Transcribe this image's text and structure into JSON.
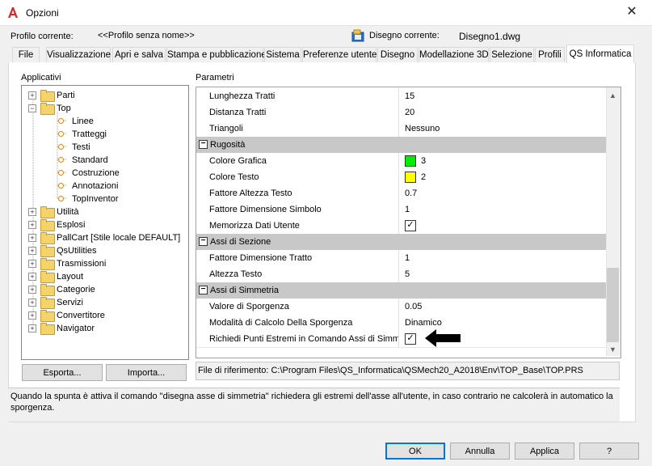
{
  "window": {
    "title": "Opzioni",
    "close_glyph": "✕"
  },
  "header": {
    "profile_label": "Profilo corrente:",
    "profile_value": "<<Profilo senza nome>>",
    "drawing_label": "Disegno corrente:",
    "drawing_value": "Disegno1.dwg"
  },
  "tabs": [
    {
      "label": "File"
    },
    {
      "label": "Visualizzazione"
    },
    {
      "label": "Apri e salva"
    },
    {
      "label": "Stampa e pubblicazione"
    },
    {
      "label": "Sistema"
    },
    {
      "label": "Preferenze utente"
    },
    {
      "label": "Disegno"
    },
    {
      "label": "Modellazione 3D"
    },
    {
      "label": "Selezione"
    },
    {
      "label": "Profili"
    },
    {
      "label": "QS Informatica",
      "active": true
    }
  ],
  "left": {
    "label": "Applicativi",
    "tree": [
      {
        "label": "Parti",
        "kind": "folder",
        "expander": "+"
      },
      {
        "label": "Top",
        "kind": "folder",
        "expander": "−"
      },
      {
        "label": "Linee",
        "kind": "leaf"
      },
      {
        "label": "Tratteggi",
        "kind": "leaf"
      },
      {
        "label": "Testi",
        "kind": "leaf"
      },
      {
        "label": "Standard",
        "kind": "leaf"
      },
      {
        "label": "Costruzione",
        "kind": "leaf"
      },
      {
        "label": "Annotazioni",
        "kind": "leaf"
      },
      {
        "label": "TopInventor",
        "kind": "leaf"
      },
      {
        "label": "Utilità",
        "kind": "folder",
        "expander": "+"
      },
      {
        "label": "Esplosi",
        "kind": "folder",
        "expander": "+"
      },
      {
        "label": "PallCart [Stile locale DEFAULT]",
        "kind": "folder",
        "expander": "+"
      },
      {
        "label": "QsUtilities",
        "kind": "folder",
        "expander": "+"
      },
      {
        "label": "Trasmissioni",
        "kind": "folder",
        "expander": "+"
      },
      {
        "label": "Layout",
        "kind": "folder",
        "expander": "+"
      },
      {
        "label": "Categorie",
        "kind": "folder",
        "expander": "+"
      },
      {
        "label": "Servizi",
        "kind": "folder",
        "expander": "+"
      },
      {
        "label": "Convertitore",
        "kind": "folder",
        "expander": "+"
      },
      {
        "label": "Navigator",
        "kind": "folder",
        "expander": "+"
      }
    ],
    "export_button": "Esporta...",
    "import_button": "Importa..."
  },
  "params": {
    "label": "Parametri",
    "rows": [
      {
        "type": "prop",
        "name": "Lunghezza Tratti",
        "value": "15"
      },
      {
        "type": "prop",
        "name": "Distanza Tratti",
        "value": "20"
      },
      {
        "type": "prop",
        "name": "Triangoli",
        "value": "Nessuno"
      },
      {
        "type": "cat",
        "name": "Rugosità"
      },
      {
        "type": "prop",
        "name": "Colore Grafica",
        "value": "3",
        "swatch": "#00ee00"
      },
      {
        "type": "prop",
        "name": "Colore Testo",
        "value": "2",
        "swatch": "#ffff00"
      },
      {
        "type": "prop",
        "name": "Fattore Altezza Testo",
        "value": "0.7"
      },
      {
        "type": "prop",
        "name": "Fattore Dimensione Simbolo",
        "value": "1"
      },
      {
        "type": "prop",
        "name": "Memorizza Dati Utente",
        "check": "✓"
      },
      {
        "type": "cat",
        "name": "Assi di Sezione"
      },
      {
        "type": "prop",
        "name": "Fattore Dimensione Tratto",
        "value": "1"
      },
      {
        "type": "prop",
        "name": "Altezza Testo",
        "value": "5"
      },
      {
        "type": "cat",
        "name": "Assi di Simmetria"
      },
      {
        "type": "prop",
        "name": "Valore di Sporgenza",
        "value": "0.05"
      },
      {
        "type": "prop",
        "name": "Modalità di Calcolo Della Sporgenza",
        "value": "Dinamico"
      },
      {
        "type": "prop",
        "name": "Richiedi Punti Estremi in Comando Assi di Simmetri",
        "check": "✓"
      }
    ],
    "file_ref": "File di riferimento: C:\\Program Files\\QS_Informatica\\QSMech20_A2018\\Env\\TOP_Base\\TOP.PRS"
  },
  "description": "Quando la spunta è attiva il comando \"disegna asse di simmetria\" richiedera gli estremi dell'asse all'utente, in caso contrario ne calcolerà in automatico la sporgenza.",
  "footer": {
    "ok": "OK",
    "cancel": "Annulla",
    "apply": "Applica",
    "help": "?"
  }
}
